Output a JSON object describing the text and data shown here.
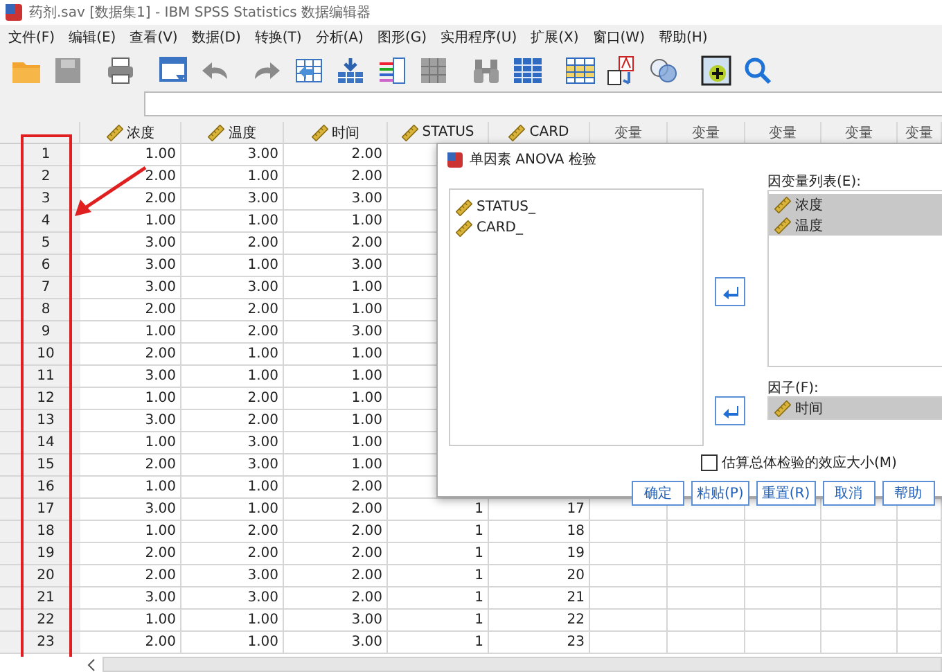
{
  "window": {
    "title": "药剂.sav [数据集1] - IBM SPSS Statistics 数据编辑器"
  },
  "menu": [
    "文件(F)",
    "编辑(E)",
    "查看(V)",
    "数据(D)",
    "转换(T)",
    "分析(A)",
    "图形(G)",
    "实用程序(U)",
    "扩展(X)",
    "窗口(W)",
    "帮助(H)"
  ],
  "grid": {
    "columns": [
      {
        "label": "浓度",
        "kind": "variable"
      },
      {
        "label": "温度",
        "kind": "variable"
      },
      {
        "label": "时间",
        "kind": "variable"
      },
      {
        "label": "STATUS",
        "kind": "variable"
      },
      {
        "label": "CARD",
        "kind": "variable"
      },
      {
        "label": "变量",
        "kind": "empty"
      },
      {
        "label": "变量",
        "kind": "empty"
      },
      {
        "label": "变量",
        "kind": "empty"
      },
      {
        "label": "变量",
        "kind": "empty"
      },
      {
        "label": "变量",
        "kind": "empty"
      }
    ],
    "rows": [
      {
        "number": "1",
        "cells": [
          "1.00",
          "3.00",
          "2.00"
        ]
      },
      {
        "number": "2",
        "cells": [
          "2.00",
          "1.00",
          "2.00"
        ]
      },
      {
        "number": "3",
        "cells": [
          "2.00",
          "3.00",
          "3.00"
        ]
      },
      {
        "number": "4",
        "cells": [
          "1.00",
          "1.00",
          "1.00"
        ]
      },
      {
        "number": "5",
        "cells": [
          "3.00",
          "2.00",
          "2.00"
        ]
      },
      {
        "number": "6",
        "cells": [
          "3.00",
          "1.00",
          "3.00"
        ]
      },
      {
        "number": "7",
        "cells": [
          "3.00",
          "3.00",
          "1.00"
        ]
      },
      {
        "number": "8",
        "cells": [
          "2.00",
          "2.00",
          "1.00"
        ]
      },
      {
        "number": "9",
        "cells": [
          "1.00",
          "2.00",
          "3.00"
        ]
      },
      {
        "number": "10",
        "cells": [
          "2.00",
          "1.00",
          "1.00"
        ]
      },
      {
        "number": "11",
        "cells": [
          "3.00",
          "1.00",
          "1.00"
        ]
      },
      {
        "number": "12",
        "cells": [
          "1.00",
          "2.00",
          "1.00"
        ]
      },
      {
        "number": "13",
        "cells": [
          "3.00",
          "2.00",
          "1.00"
        ]
      },
      {
        "number": "14",
        "cells": [
          "1.00",
          "3.00",
          "1.00"
        ]
      },
      {
        "number": "15",
        "cells": [
          "2.00",
          "3.00",
          "1.00"
        ]
      },
      {
        "number": "16",
        "cells": [
          "1.00",
          "1.00",
          "2.00"
        ]
      },
      {
        "number": "17",
        "cells": [
          "3.00",
          "1.00",
          "2.00",
          "1",
          "17"
        ]
      },
      {
        "number": "18",
        "cells": [
          "1.00",
          "2.00",
          "2.00",
          "1",
          "18"
        ]
      },
      {
        "number": "19",
        "cells": [
          "2.00",
          "2.00",
          "2.00",
          "1",
          "19"
        ]
      },
      {
        "number": "20",
        "cells": [
          "2.00",
          "3.00",
          "2.00",
          "1",
          "20"
        ]
      },
      {
        "number": "21",
        "cells": [
          "3.00",
          "3.00",
          "2.00",
          "1",
          "21"
        ]
      },
      {
        "number": "22",
        "cells": [
          "1.00",
          "1.00",
          "3.00",
          "1",
          "22"
        ]
      },
      {
        "number": "23",
        "cells": [
          "2.00",
          "1.00",
          "3.00",
          "1",
          "23"
        ]
      }
    ]
  },
  "dialog": {
    "title": "单因素 ANOVA 检验",
    "source_list": [
      "STATUS_",
      "CARD_"
    ],
    "dependent_label": "因变量列表(E):",
    "dependent_list": [
      {
        "label": "浓度",
        "selected": true
      },
      {
        "label": "温度",
        "selected": true
      }
    ],
    "factor_label": "因子(F):",
    "factor": {
      "label": "时间",
      "selected": true
    },
    "effect_size": {
      "label": "估算总体检验的效应大小(M)",
      "checked": false
    },
    "buttons": [
      "确定",
      "粘贴(P)",
      "重置(R)",
      "取消",
      "帮助"
    ]
  }
}
